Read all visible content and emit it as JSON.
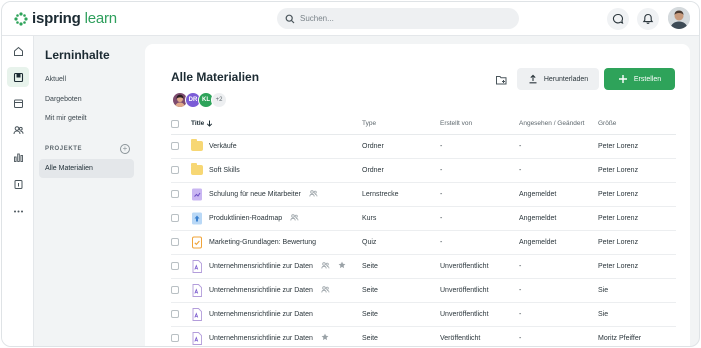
{
  "brand": {
    "name_prefix": "ispring",
    "name_suffix": "learn",
    "accent": "#2ea35a"
  },
  "search": {
    "placeholder": "Suchen..."
  },
  "topbar": {
    "icons": [
      "chat-icon",
      "bell-icon"
    ]
  },
  "rail": {
    "items": [
      "home-icon",
      "book-icon",
      "calendar-icon",
      "users-icon",
      "chart-icon",
      "report-icon",
      "more-icon"
    ],
    "active": "book-icon"
  },
  "sidenav": {
    "title": "Lerninhalte",
    "links": [
      "Aktuell",
      "Dargeboten",
      "Mit mir geteilt"
    ],
    "section_label": "PROJEKTE",
    "active_item": "Alle Materialien"
  },
  "main": {
    "title": "Alle Materialien",
    "avatars": [
      {
        "initials": "",
        "color": "#7d4b6e"
      },
      {
        "initials": "DR",
        "color": "#7a5cd6"
      },
      {
        "initials": "KL",
        "color": "#2ea35a"
      },
      {
        "initials": "+2",
        "color": "#edeff1"
      }
    ],
    "download_label": "Herunterladen",
    "create_label": "Erstellen",
    "columns": {
      "title": "Title",
      "type": "Type",
      "created_by": "Erstellt von",
      "seen": "Angesehen / Geändert",
      "size": "Größe"
    },
    "rows": [
      {
        "icon": "folder",
        "title": "Verkäufe",
        "shared": false,
        "starred": false,
        "type": "Ordner",
        "created_by": "-",
        "seen": "-",
        "size": "Peter Lorenz"
      },
      {
        "icon": "folder",
        "title": "Soft Skills",
        "shared": false,
        "starred": false,
        "type": "Ordner",
        "created_by": "-",
        "seen": "-",
        "size": "Peter Lorenz"
      },
      {
        "icon": "path",
        "title": "Schulung für neue Mitarbeiter",
        "shared": true,
        "starred": false,
        "type": "Lernstrecke",
        "created_by": "-",
        "seen": "Angemeldet",
        "size": "Peter Lorenz"
      },
      {
        "icon": "course",
        "title": "Produktlinien-Roadmap",
        "shared": true,
        "starred": false,
        "type": "Kurs",
        "created_by": "-",
        "seen": "Angemeldet",
        "size": "Peter Lorenz"
      },
      {
        "icon": "quiz",
        "title": "Marketing-Grundlagen: Bewertung",
        "shared": false,
        "starred": false,
        "type": "Quiz",
        "created_by": "-",
        "seen": "Angemeldet",
        "size": "Peter Lorenz"
      },
      {
        "icon": "page",
        "title": "Unternehmensrichtlinie zur Daten",
        "shared": true,
        "starred": true,
        "type": "Seite",
        "created_by": "Unveröffentlicht",
        "seen": "-",
        "size": "Peter Lorenz"
      },
      {
        "icon": "page",
        "title": "Unternehmensrichtlinie zur Daten",
        "shared": true,
        "starred": false,
        "type": "Seite",
        "created_by": "Unveröffentlicht",
        "seen": "-",
        "size": "Sie"
      },
      {
        "icon": "page",
        "title": "Unternehmensrichtlinie zur Daten",
        "shared": false,
        "starred": false,
        "type": "Seite",
        "created_by": "Unveröffentlicht",
        "seen": "-",
        "size": "Sie"
      },
      {
        "icon": "page",
        "title": "Unternehmensrichtlinie zur Daten",
        "shared": false,
        "starred": true,
        "type": "Seite",
        "created_by": "Veröffentlicht",
        "seen": "-",
        "size": "Moritz Pfeiffer"
      }
    ]
  }
}
